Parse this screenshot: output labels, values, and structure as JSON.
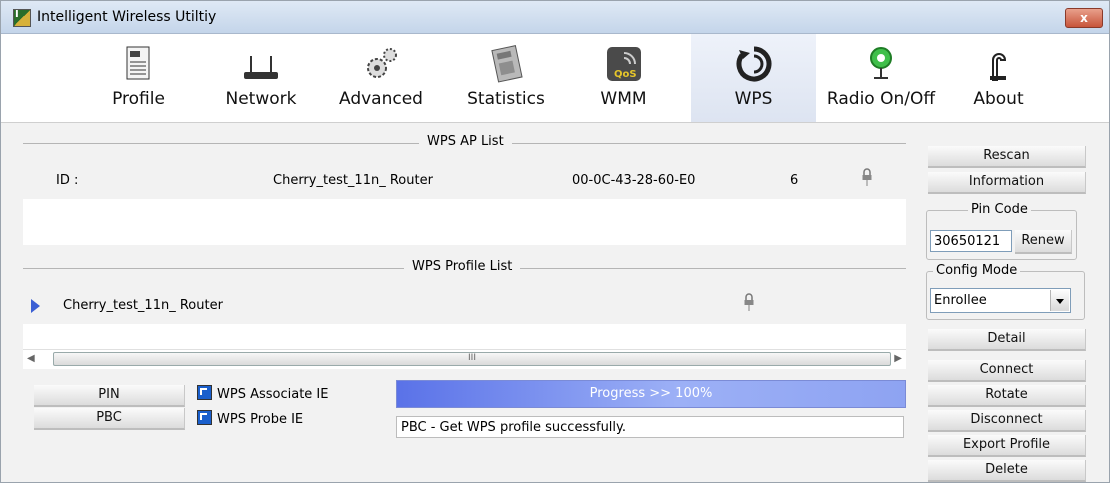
{
  "window": {
    "title": "Intelligent Wireless Utiltiy",
    "close_label": "x"
  },
  "toolbar": {
    "items": [
      {
        "label": "Profile",
        "icon": "profile-icon"
      },
      {
        "label": "Network",
        "icon": "network-icon"
      },
      {
        "label": "Advanced",
        "icon": "advanced-icon"
      },
      {
        "label": "Statistics",
        "icon": "statistics-icon"
      },
      {
        "label": "WMM",
        "icon": "wmm-icon"
      },
      {
        "label": "WPS",
        "icon": "wps-icon",
        "active": true
      },
      {
        "label": "Radio On/Off",
        "icon": "radio-icon"
      },
      {
        "label": "About",
        "icon": "about-icon"
      }
    ]
  },
  "wps_ap_list": {
    "title": "WPS AP List",
    "rows": [
      {
        "id_label": "ID :",
        "ssid": "Cherry_test_11n_ Router",
        "bssid": "00-0C-43-28-60-E0",
        "channel": "6"
      }
    ]
  },
  "wps_profile_list": {
    "title": "WPS Profile List",
    "rows": [
      {
        "ssid": "Cherry_test_11n_ Router"
      }
    ]
  },
  "scrollbar": {
    "thumb_glyph": "III"
  },
  "buttons": {
    "pin": "PIN",
    "pbc": "PBC",
    "rescan": "Rescan",
    "information": "Information",
    "renew": "Renew",
    "detail": "Detail",
    "connect": "Connect",
    "rotate": "Rotate",
    "disconnect": "Disconnect",
    "export_profile": "Export Profile",
    "delete": "Delete"
  },
  "checkboxes": {
    "associate_ie": "WPS Associate IE",
    "probe_ie": "WPS Probe IE"
  },
  "progress": {
    "text": "Progress >> 100%",
    "percent": 100
  },
  "status": {
    "text": "PBC - Get WPS profile successfully."
  },
  "pin_code": {
    "legend": "Pin Code",
    "value": "30650121"
  },
  "config_mode": {
    "legend": "Config Mode",
    "selected": "Enrollee"
  }
}
